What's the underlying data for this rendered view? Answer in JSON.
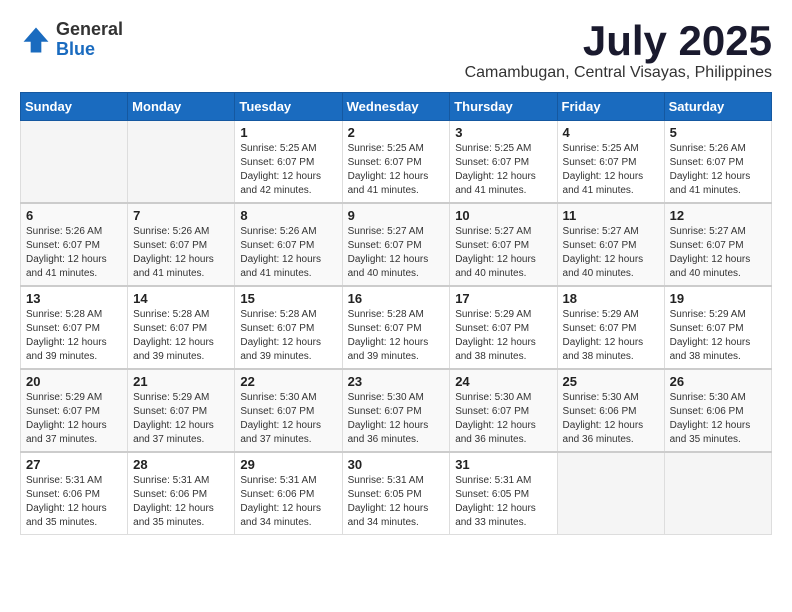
{
  "header": {
    "logo": {
      "general": "General",
      "blue": "Blue"
    },
    "month": "July 2025",
    "location": "Camambugan, Central Visayas, Philippines"
  },
  "weekdays": [
    "Sunday",
    "Monday",
    "Tuesday",
    "Wednesday",
    "Thursday",
    "Friday",
    "Saturday"
  ],
  "weeks": [
    [
      {
        "day": "",
        "sunrise": "",
        "sunset": "",
        "daylight": ""
      },
      {
        "day": "",
        "sunrise": "",
        "sunset": "",
        "daylight": ""
      },
      {
        "day": "1",
        "sunrise": "Sunrise: 5:25 AM",
        "sunset": "Sunset: 6:07 PM",
        "daylight": "Daylight: 12 hours and 42 minutes."
      },
      {
        "day": "2",
        "sunrise": "Sunrise: 5:25 AM",
        "sunset": "Sunset: 6:07 PM",
        "daylight": "Daylight: 12 hours and 41 minutes."
      },
      {
        "day": "3",
        "sunrise": "Sunrise: 5:25 AM",
        "sunset": "Sunset: 6:07 PM",
        "daylight": "Daylight: 12 hours and 41 minutes."
      },
      {
        "day": "4",
        "sunrise": "Sunrise: 5:25 AM",
        "sunset": "Sunset: 6:07 PM",
        "daylight": "Daylight: 12 hours and 41 minutes."
      },
      {
        "day": "5",
        "sunrise": "Sunrise: 5:26 AM",
        "sunset": "Sunset: 6:07 PM",
        "daylight": "Daylight: 12 hours and 41 minutes."
      }
    ],
    [
      {
        "day": "6",
        "sunrise": "Sunrise: 5:26 AM",
        "sunset": "Sunset: 6:07 PM",
        "daylight": "Daylight: 12 hours and 41 minutes."
      },
      {
        "day": "7",
        "sunrise": "Sunrise: 5:26 AM",
        "sunset": "Sunset: 6:07 PM",
        "daylight": "Daylight: 12 hours and 41 minutes."
      },
      {
        "day": "8",
        "sunrise": "Sunrise: 5:26 AM",
        "sunset": "Sunset: 6:07 PM",
        "daylight": "Daylight: 12 hours and 41 minutes."
      },
      {
        "day": "9",
        "sunrise": "Sunrise: 5:27 AM",
        "sunset": "Sunset: 6:07 PM",
        "daylight": "Daylight: 12 hours and 40 minutes."
      },
      {
        "day": "10",
        "sunrise": "Sunrise: 5:27 AM",
        "sunset": "Sunset: 6:07 PM",
        "daylight": "Daylight: 12 hours and 40 minutes."
      },
      {
        "day": "11",
        "sunrise": "Sunrise: 5:27 AM",
        "sunset": "Sunset: 6:07 PM",
        "daylight": "Daylight: 12 hours and 40 minutes."
      },
      {
        "day": "12",
        "sunrise": "Sunrise: 5:27 AM",
        "sunset": "Sunset: 6:07 PM",
        "daylight": "Daylight: 12 hours and 40 minutes."
      }
    ],
    [
      {
        "day": "13",
        "sunrise": "Sunrise: 5:28 AM",
        "sunset": "Sunset: 6:07 PM",
        "daylight": "Daylight: 12 hours and 39 minutes."
      },
      {
        "day": "14",
        "sunrise": "Sunrise: 5:28 AM",
        "sunset": "Sunset: 6:07 PM",
        "daylight": "Daylight: 12 hours and 39 minutes."
      },
      {
        "day": "15",
        "sunrise": "Sunrise: 5:28 AM",
        "sunset": "Sunset: 6:07 PM",
        "daylight": "Daylight: 12 hours and 39 minutes."
      },
      {
        "day": "16",
        "sunrise": "Sunrise: 5:28 AM",
        "sunset": "Sunset: 6:07 PM",
        "daylight": "Daylight: 12 hours and 39 minutes."
      },
      {
        "day": "17",
        "sunrise": "Sunrise: 5:29 AM",
        "sunset": "Sunset: 6:07 PM",
        "daylight": "Daylight: 12 hours and 38 minutes."
      },
      {
        "day": "18",
        "sunrise": "Sunrise: 5:29 AM",
        "sunset": "Sunset: 6:07 PM",
        "daylight": "Daylight: 12 hours and 38 minutes."
      },
      {
        "day": "19",
        "sunrise": "Sunrise: 5:29 AM",
        "sunset": "Sunset: 6:07 PM",
        "daylight": "Daylight: 12 hours and 38 minutes."
      }
    ],
    [
      {
        "day": "20",
        "sunrise": "Sunrise: 5:29 AM",
        "sunset": "Sunset: 6:07 PM",
        "daylight": "Daylight: 12 hours and 37 minutes."
      },
      {
        "day": "21",
        "sunrise": "Sunrise: 5:29 AM",
        "sunset": "Sunset: 6:07 PM",
        "daylight": "Daylight: 12 hours and 37 minutes."
      },
      {
        "day": "22",
        "sunrise": "Sunrise: 5:30 AM",
        "sunset": "Sunset: 6:07 PM",
        "daylight": "Daylight: 12 hours and 37 minutes."
      },
      {
        "day": "23",
        "sunrise": "Sunrise: 5:30 AM",
        "sunset": "Sunset: 6:07 PM",
        "daylight": "Daylight: 12 hours and 36 minutes."
      },
      {
        "day": "24",
        "sunrise": "Sunrise: 5:30 AM",
        "sunset": "Sunset: 6:07 PM",
        "daylight": "Daylight: 12 hours and 36 minutes."
      },
      {
        "day": "25",
        "sunrise": "Sunrise: 5:30 AM",
        "sunset": "Sunset: 6:06 PM",
        "daylight": "Daylight: 12 hours and 36 minutes."
      },
      {
        "day": "26",
        "sunrise": "Sunrise: 5:30 AM",
        "sunset": "Sunset: 6:06 PM",
        "daylight": "Daylight: 12 hours and 35 minutes."
      }
    ],
    [
      {
        "day": "27",
        "sunrise": "Sunrise: 5:31 AM",
        "sunset": "Sunset: 6:06 PM",
        "daylight": "Daylight: 12 hours and 35 minutes."
      },
      {
        "day": "28",
        "sunrise": "Sunrise: 5:31 AM",
        "sunset": "Sunset: 6:06 PM",
        "daylight": "Daylight: 12 hours and 35 minutes."
      },
      {
        "day": "29",
        "sunrise": "Sunrise: 5:31 AM",
        "sunset": "Sunset: 6:06 PM",
        "daylight": "Daylight: 12 hours and 34 minutes."
      },
      {
        "day": "30",
        "sunrise": "Sunrise: 5:31 AM",
        "sunset": "Sunset: 6:05 PM",
        "daylight": "Daylight: 12 hours and 34 minutes."
      },
      {
        "day": "31",
        "sunrise": "Sunrise: 5:31 AM",
        "sunset": "Sunset: 6:05 PM",
        "daylight": "Daylight: 12 hours and 33 minutes."
      },
      {
        "day": "",
        "sunrise": "",
        "sunset": "",
        "daylight": ""
      },
      {
        "day": "",
        "sunrise": "",
        "sunset": "",
        "daylight": ""
      }
    ]
  ]
}
